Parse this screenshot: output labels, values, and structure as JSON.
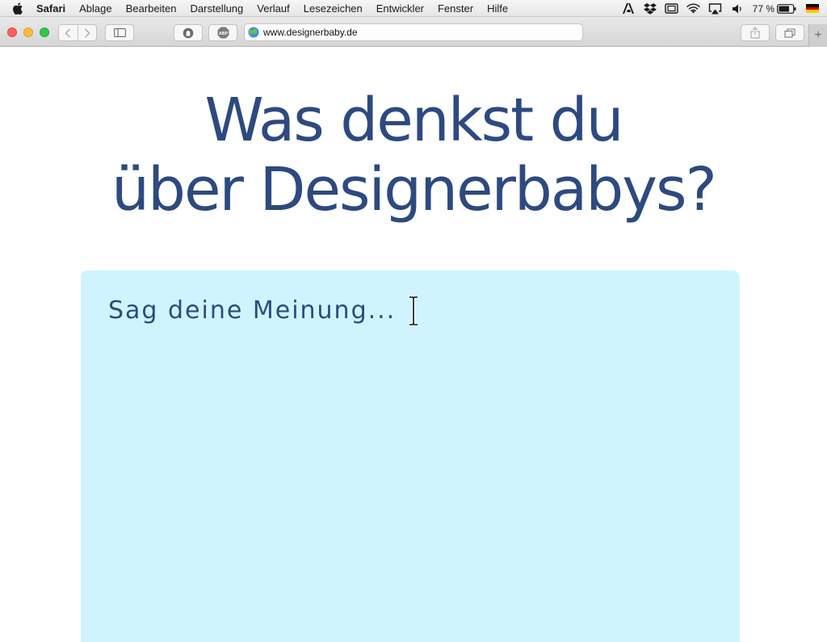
{
  "menubar": {
    "app_name": "Safari",
    "items": [
      "Ablage",
      "Bearbeiten",
      "Darstellung",
      "Verlauf",
      "Lesezeichen",
      "Entwickler",
      "Fenster",
      "Hilfe"
    ],
    "battery_text": "77 %"
  },
  "browser": {
    "url": "www.designerbaby.de"
  },
  "page": {
    "headline_line1": "Was denkst du",
    "headline_line2": "über Designerbabys?",
    "opinion_placeholder": "Sag deine Meinung..."
  },
  "colors": {
    "headline": "#2d4a80",
    "opinion_box": "#cff4fd",
    "background": "#ffffff"
  }
}
